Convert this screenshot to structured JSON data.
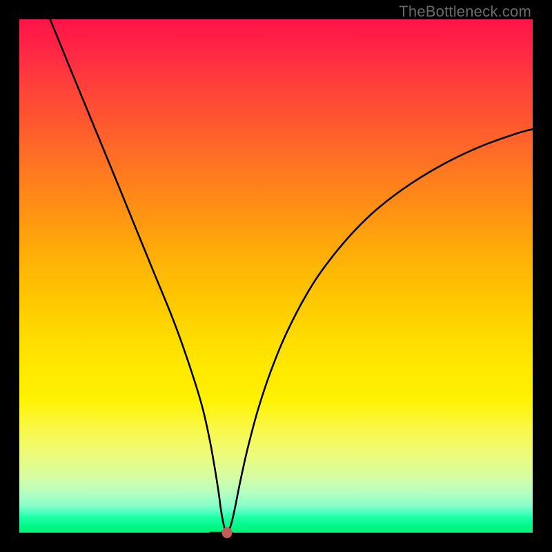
{
  "watermark": "TheBottleneck.com",
  "chart_data": {
    "type": "line",
    "title": "",
    "xlabel": "",
    "ylabel": "",
    "xlim": [
      0,
      100
    ],
    "ylim": [
      0,
      100
    ],
    "series": [
      {
        "name": "bottleneck-curve",
        "x": [
          6,
          10,
          14,
          18,
          22,
          26,
          30,
          33,
          35.5,
          37,
          38,
          38.8,
          39.3,
          39.8,
          40.2,
          40.7,
          41.3,
          42,
          43,
          44.5,
          46.5,
          49,
          52,
          56,
          60,
          65,
          70,
          76,
          83,
          90,
          97,
          100
        ],
        "y": [
          100,
          90.2,
          80.5,
          70.8,
          61.0,
          51.2,
          41.4,
          33.0,
          25.0,
          18.5,
          13.0,
          8.0,
          4.3,
          1.6,
          0.3,
          0.3,
          1.8,
          4.8,
          9.8,
          16.5,
          24.0,
          31.5,
          38.8,
          46.5,
          52.5,
          58.5,
          63.3,
          67.8,
          72.0,
          75.3,
          77.8,
          78.6
        ]
      },
      {
        "name": "baseline-flat",
        "x": [
          37.2,
          41.4
        ],
        "y": [
          0.0,
          0.0
        ]
      }
    ],
    "marker": {
      "x": 40.4,
      "y": 0.0,
      "color": "#c75a58"
    },
    "gradient_stops": [
      {
        "pos": 0.0,
        "color": "#ff1449"
      },
      {
        "pos": 0.5,
        "color": "#ffc600"
      },
      {
        "pos": 0.8,
        "color": "#f9f84a"
      },
      {
        "pos": 1.0,
        "color": "#00f078"
      }
    ]
  }
}
